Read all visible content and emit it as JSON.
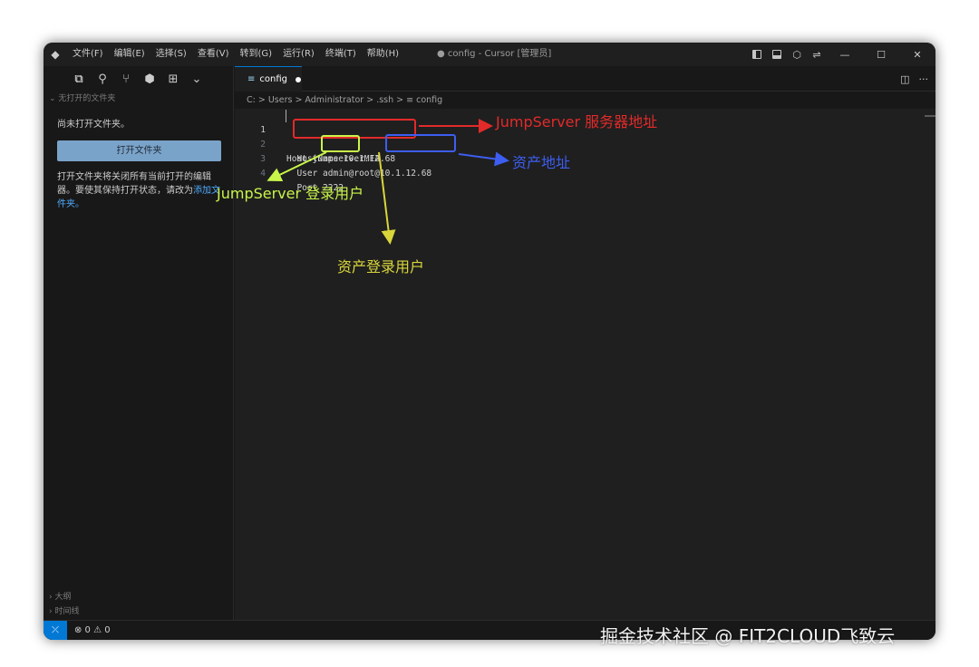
{
  "app": {
    "window_title": "● config - Cursor [管理员]",
    "menu": [
      "文件(F)",
      "编辑(E)",
      "选择(S)",
      "查看(V)",
      "转到(G)",
      "运行(R)",
      "终端(T)",
      "帮助(H)"
    ]
  },
  "sidebar": {
    "header": "无打开的文件夹",
    "no_folder_text": "尚未打开文件夹。",
    "open_folder_button": "打开文件夹",
    "desc_prefix": "打开文件夹将关闭所有当前打开的编辑器。要使其保持打开状态，请改为",
    "desc_link": "添加文件夹。",
    "outline": "大纲",
    "timeline": "时间线"
  },
  "editor": {
    "tab_label": "config",
    "breadcrumb": "C: > Users > Administrator > .ssh > ≡ config",
    "lines": [
      {
        "num": "1",
        "text": "Host jumpserverMFA"
      },
      {
        "num": "2",
        "text": "  HostName 10.1.12.68"
      },
      {
        "num": "3",
        "text": "  User admin@root@10.1.12.68"
      },
      {
        "num": "4",
        "text": "  Port 2222"
      }
    ]
  },
  "status": {
    "problems": "⊗ 0 ⚠ 0"
  },
  "annotations": {
    "red": "JumpServer 服务器地址",
    "blue": "资产地址",
    "green": "JumpServer 登录用户",
    "yellow": "资产登录用户"
  },
  "watermark": "掘金技术社区 @ FIT2CLOUD飞致云",
  "colors": {
    "accent": "#0078d4",
    "red": "#e22a2a",
    "blue": "#3d5ef0",
    "green": "#c9f54a",
    "yellow": "#d9d63b"
  }
}
